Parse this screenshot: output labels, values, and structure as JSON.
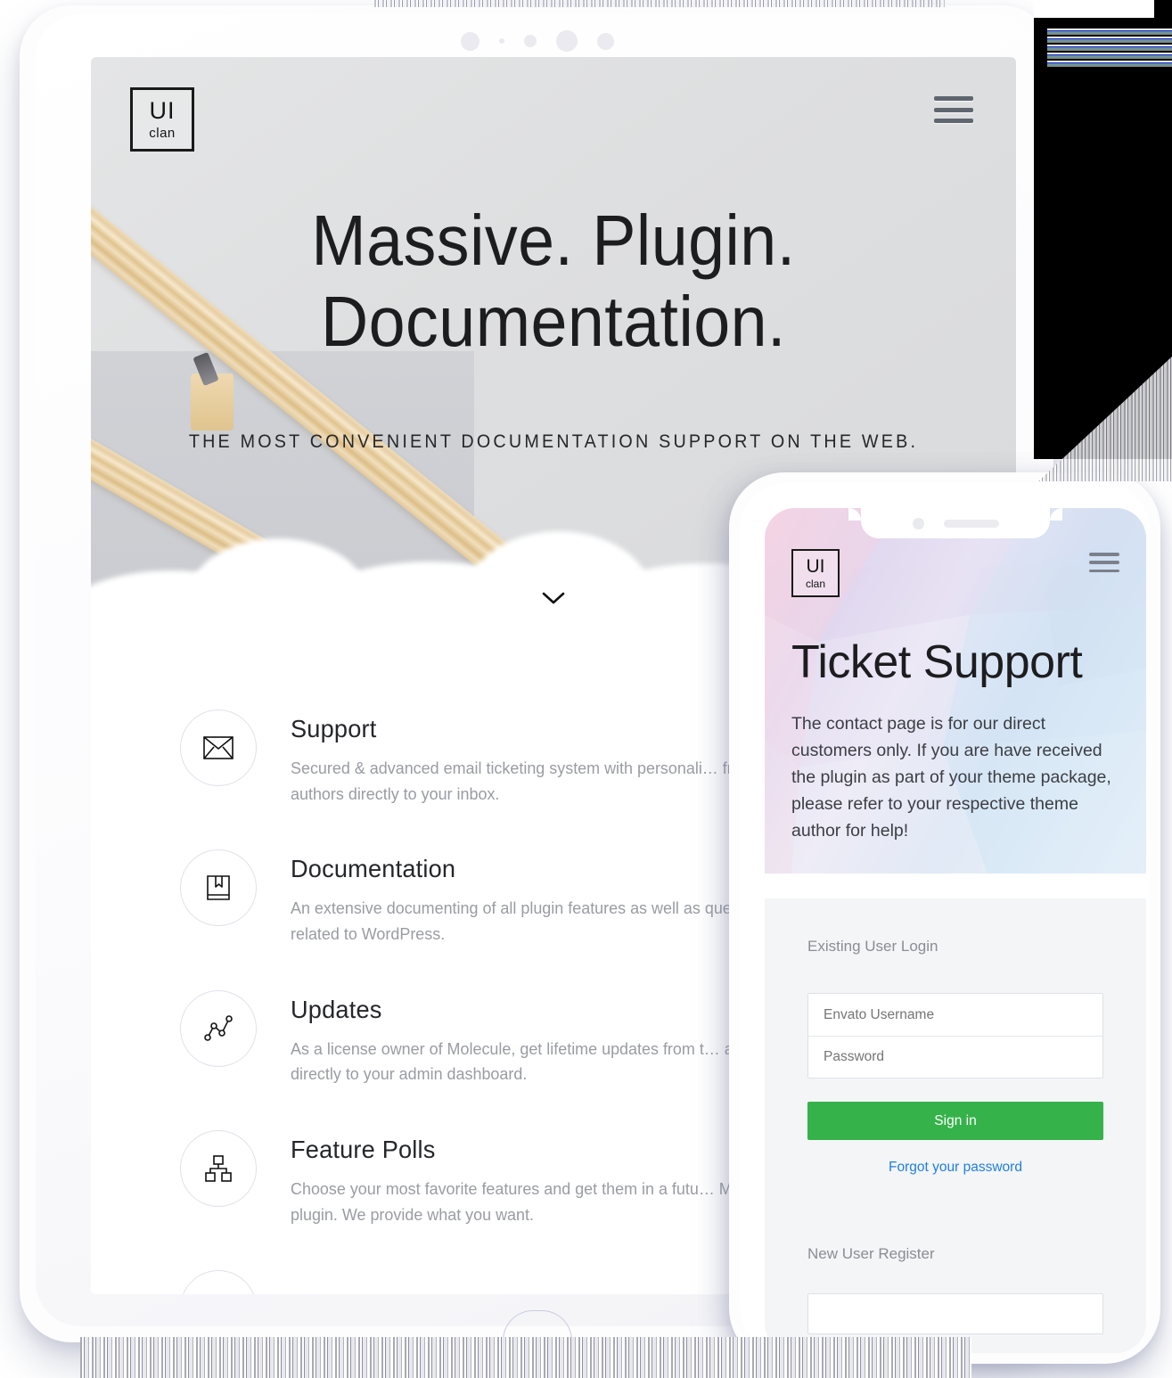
{
  "tablet": {
    "logo": {
      "line1": "UI",
      "line2": "clan"
    },
    "menu_icon": "hamburger-icon",
    "hero": {
      "title_line1": "Massive. Plugin.",
      "title_line2": "Documentation.",
      "subtitle": "THE MOST CONVENIENT DOCUMENTATION SUPPORT ON THE WEB.",
      "scroll_icon": "chevron-down-icon"
    },
    "features": [
      {
        "icon": "envelope-icon",
        "title": "Support",
        "desc": "Secured & advanced email ticketing system with personali… from the authors directly to your inbox."
      },
      {
        "icon": "book-bookmark-icon",
        "title": "Documentation",
        "desc": "An extensive documenting of all plugin features as well as questions related to WordPress."
      },
      {
        "icon": "line-chart-icon",
        "title": "Updates",
        "desc": "As a license owner of Molecule, get lifetime updates from t… authors directly to your admin dashboard."
      },
      {
        "icon": "sitemap-icon",
        "title": "Feature Polls",
        "desc": "Choose your most favorite features and get them in a futu… Molecule plugin. We provide what you want."
      }
    ]
  },
  "phone": {
    "logo": {
      "line1": "UI",
      "line2": "clan"
    },
    "menu_icon": "hamburger-icon",
    "title": "Ticket Support",
    "paragraph": "The contact page is for our direct customers only. If you are have received the plugin as part of your theme package, please refer to your respective theme author for help!",
    "login": {
      "heading": "Existing User Login",
      "username_placeholder": "Envato Username",
      "username_value": "",
      "password_placeholder": "Password",
      "password_value": "",
      "signin_label": "Sign in",
      "forgot_label": "Forgot your password"
    },
    "register": {
      "heading": "New User Register"
    }
  },
  "colors": {
    "signin_green": "#35b24a",
    "link_blue": "#1f7fe0",
    "text_dark": "#1d1d1f",
    "text_muted": "#9a9ca3"
  }
}
